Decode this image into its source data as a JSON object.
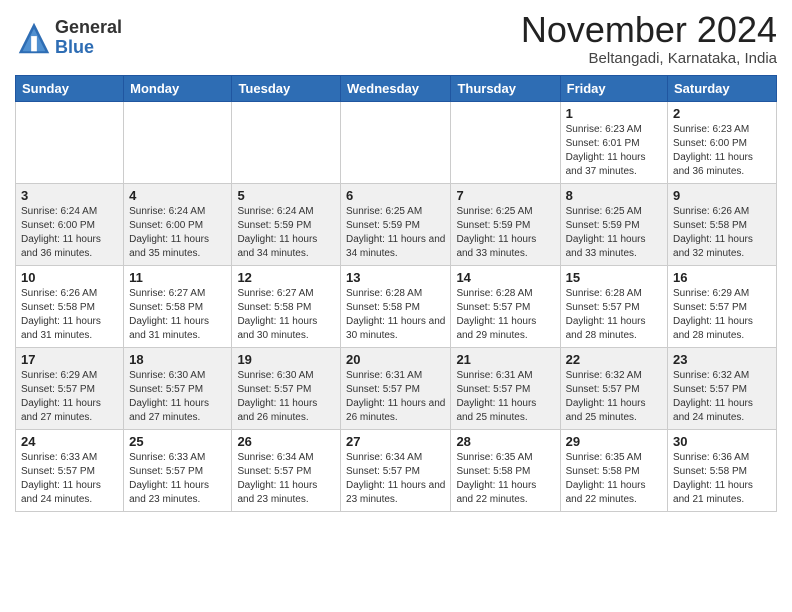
{
  "logo": {
    "general": "General",
    "blue": "Blue"
  },
  "header": {
    "month": "November 2024",
    "location": "Beltangadi, Karnataka, India"
  },
  "days_of_week": [
    "Sunday",
    "Monday",
    "Tuesday",
    "Wednesday",
    "Thursday",
    "Friday",
    "Saturday"
  ],
  "weeks": [
    [
      {
        "day": "",
        "info": ""
      },
      {
        "day": "",
        "info": ""
      },
      {
        "day": "",
        "info": ""
      },
      {
        "day": "",
        "info": ""
      },
      {
        "day": "",
        "info": ""
      },
      {
        "day": "1",
        "info": "Sunrise: 6:23 AM\nSunset: 6:01 PM\nDaylight: 11 hours and 37 minutes."
      },
      {
        "day": "2",
        "info": "Sunrise: 6:23 AM\nSunset: 6:00 PM\nDaylight: 11 hours and 36 minutes."
      }
    ],
    [
      {
        "day": "3",
        "info": "Sunrise: 6:24 AM\nSunset: 6:00 PM\nDaylight: 11 hours and 36 minutes."
      },
      {
        "day": "4",
        "info": "Sunrise: 6:24 AM\nSunset: 6:00 PM\nDaylight: 11 hours and 35 minutes."
      },
      {
        "day": "5",
        "info": "Sunrise: 6:24 AM\nSunset: 5:59 PM\nDaylight: 11 hours and 34 minutes."
      },
      {
        "day": "6",
        "info": "Sunrise: 6:25 AM\nSunset: 5:59 PM\nDaylight: 11 hours and 34 minutes."
      },
      {
        "day": "7",
        "info": "Sunrise: 6:25 AM\nSunset: 5:59 PM\nDaylight: 11 hours and 33 minutes."
      },
      {
        "day": "8",
        "info": "Sunrise: 6:25 AM\nSunset: 5:59 PM\nDaylight: 11 hours and 33 minutes."
      },
      {
        "day": "9",
        "info": "Sunrise: 6:26 AM\nSunset: 5:58 PM\nDaylight: 11 hours and 32 minutes."
      }
    ],
    [
      {
        "day": "10",
        "info": "Sunrise: 6:26 AM\nSunset: 5:58 PM\nDaylight: 11 hours and 31 minutes."
      },
      {
        "day": "11",
        "info": "Sunrise: 6:27 AM\nSunset: 5:58 PM\nDaylight: 11 hours and 31 minutes."
      },
      {
        "day": "12",
        "info": "Sunrise: 6:27 AM\nSunset: 5:58 PM\nDaylight: 11 hours and 30 minutes."
      },
      {
        "day": "13",
        "info": "Sunrise: 6:28 AM\nSunset: 5:58 PM\nDaylight: 11 hours and 30 minutes."
      },
      {
        "day": "14",
        "info": "Sunrise: 6:28 AM\nSunset: 5:57 PM\nDaylight: 11 hours and 29 minutes."
      },
      {
        "day": "15",
        "info": "Sunrise: 6:28 AM\nSunset: 5:57 PM\nDaylight: 11 hours and 28 minutes."
      },
      {
        "day": "16",
        "info": "Sunrise: 6:29 AM\nSunset: 5:57 PM\nDaylight: 11 hours and 28 minutes."
      }
    ],
    [
      {
        "day": "17",
        "info": "Sunrise: 6:29 AM\nSunset: 5:57 PM\nDaylight: 11 hours and 27 minutes."
      },
      {
        "day": "18",
        "info": "Sunrise: 6:30 AM\nSunset: 5:57 PM\nDaylight: 11 hours and 27 minutes."
      },
      {
        "day": "19",
        "info": "Sunrise: 6:30 AM\nSunset: 5:57 PM\nDaylight: 11 hours and 26 minutes."
      },
      {
        "day": "20",
        "info": "Sunrise: 6:31 AM\nSunset: 5:57 PM\nDaylight: 11 hours and 26 minutes."
      },
      {
        "day": "21",
        "info": "Sunrise: 6:31 AM\nSunset: 5:57 PM\nDaylight: 11 hours and 25 minutes."
      },
      {
        "day": "22",
        "info": "Sunrise: 6:32 AM\nSunset: 5:57 PM\nDaylight: 11 hours and 25 minutes."
      },
      {
        "day": "23",
        "info": "Sunrise: 6:32 AM\nSunset: 5:57 PM\nDaylight: 11 hours and 24 minutes."
      }
    ],
    [
      {
        "day": "24",
        "info": "Sunrise: 6:33 AM\nSunset: 5:57 PM\nDaylight: 11 hours and 24 minutes."
      },
      {
        "day": "25",
        "info": "Sunrise: 6:33 AM\nSunset: 5:57 PM\nDaylight: 11 hours and 23 minutes."
      },
      {
        "day": "26",
        "info": "Sunrise: 6:34 AM\nSunset: 5:57 PM\nDaylight: 11 hours and 23 minutes."
      },
      {
        "day": "27",
        "info": "Sunrise: 6:34 AM\nSunset: 5:57 PM\nDaylight: 11 hours and 23 minutes."
      },
      {
        "day": "28",
        "info": "Sunrise: 6:35 AM\nSunset: 5:58 PM\nDaylight: 11 hours and 22 minutes."
      },
      {
        "day": "29",
        "info": "Sunrise: 6:35 AM\nSunset: 5:58 PM\nDaylight: 11 hours and 22 minutes."
      },
      {
        "day": "30",
        "info": "Sunrise: 6:36 AM\nSunset: 5:58 PM\nDaylight: 11 hours and 21 minutes."
      }
    ]
  ]
}
